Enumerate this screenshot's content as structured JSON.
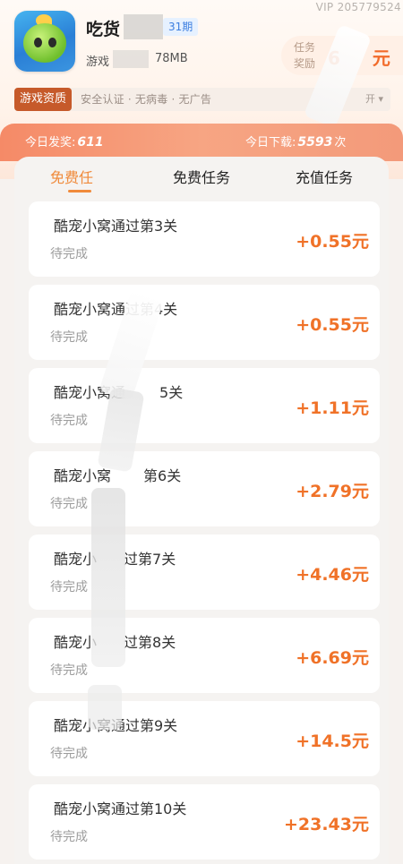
{
  "vip_id": "VIP 205779524",
  "app": {
    "name": "吃货",
    "period_badge": "31期",
    "meta_prefix": "游戏",
    "size": "78MB"
  },
  "reward": {
    "label": "任务奖励",
    "value": "6",
    "unit": "元"
  },
  "tags": {
    "chip": "游戏资质",
    "text": "安全认证 · 无病毒 · 无广告",
    "more": "开 ▾"
  },
  "stats": {
    "today_award_label": "今日发奖:",
    "today_award_value": "611",
    "today_download_label": "今日下载:",
    "today_download_value": "5593",
    "today_download_unit": "次"
  },
  "tabs": [
    {
      "label": "免费任"
    },
    {
      "label": "免费任务"
    },
    {
      "label": "充值任务"
    }
  ],
  "tasks": [
    {
      "title": "酷宠小窝通过第3关",
      "status": "待完成",
      "reward": "+0.55元"
    },
    {
      "title": "酷宠小窝通过第4关",
      "status": "待完成",
      "reward": "+0.55元"
    },
    {
      "title": "酷宠小窝通",
      "title_suffix": "5关",
      "status": "待完成",
      "reward": "+1.11元"
    },
    {
      "title": "酷宠小窝",
      "title_suffix": "第6关",
      "status": "待完成",
      "reward": "+2.79元"
    },
    {
      "title": "酷宠小",
      "title_suffix": "过第7关",
      "status": "待完成",
      "reward": "+4.46元"
    },
    {
      "title": "酷宠小",
      "title_suffix": "过第8关",
      "status": "待完成",
      "reward": "+6.69元"
    },
    {
      "title": "酷宠小窝通过第9关",
      "status": "待完成",
      "reward": "+14.5元"
    },
    {
      "title": "酷宠小窝通过第10关",
      "status": "待完成",
      "reward": "+23.43元"
    }
  ]
}
